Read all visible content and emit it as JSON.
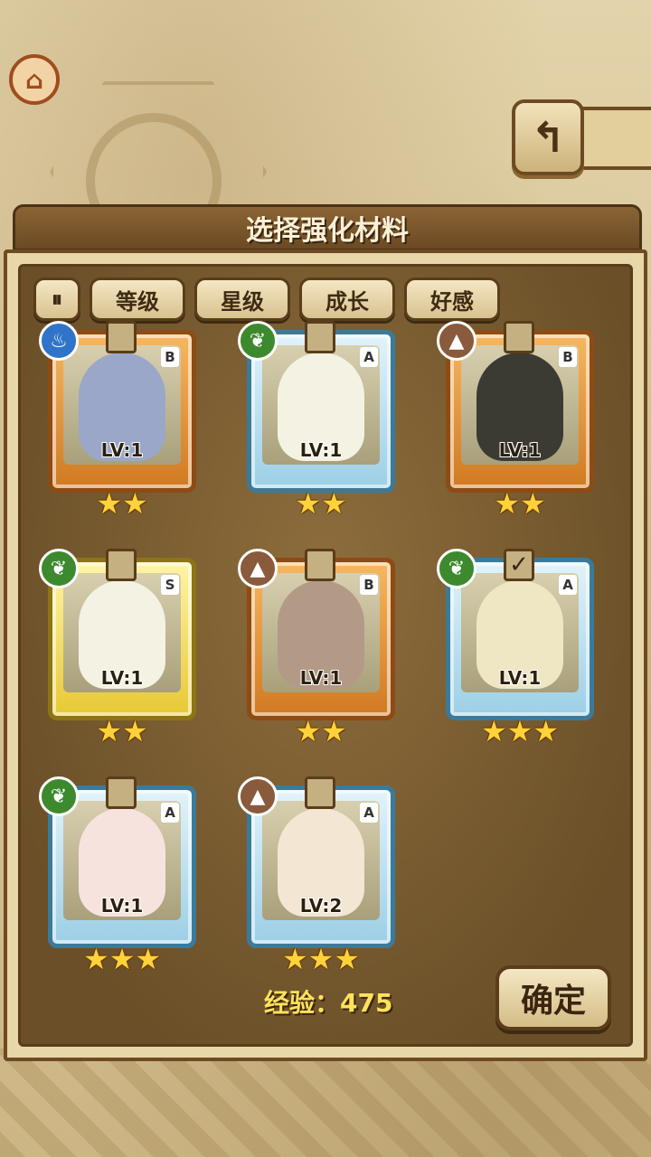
{
  "header": {
    "title": "选择强化材料",
    "back_icon": "return-arrow-icon"
  },
  "filters": {
    "toggle_icon": "sort-toggle-icon",
    "tags": [
      "等级",
      "星级",
      "成长",
      "好感"
    ]
  },
  "cards": [
    {
      "element": "water",
      "rank": "B",
      "level": "LV:1",
      "stars": 2,
      "selected": false
    },
    {
      "element": "grass",
      "rank": "A",
      "level": "LV:1",
      "stars": 2,
      "selected": false
    },
    {
      "element": "earth",
      "rank": "B",
      "level": "LV:1",
      "stars": 2,
      "selected": false
    },
    {
      "element": "grass",
      "rank": "S",
      "level": "LV:1",
      "stars": 2,
      "selected": false
    },
    {
      "element": "earth",
      "rank": "B",
      "level": "LV:1",
      "stars": 2,
      "selected": false
    },
    {
      "element": "grass",
      "rank": "A",
      "level": "LV:1",
      "stars": 3,
      "selected": true
    },
    {
      "element": "grass",
      "rank": "A",
      "level": "LV:1",
      "stars": 3,
      "selected": false
    },
    {
      "element": "earth",
      "rank": "A",
      "level": "LV:2",
      "stars": 3,
      "selected": false
    }
  ],
  "exp_label": "经验：475",
  "confirm_label": "确定",
  "colors": {
    "rank_b": "#d07a22",
    "rank_a": "#9ccfe6",
    "rank_s": "#e7c934",
    "star": "#ffd23a",
    "exp_text": "#ffe25a"
  }
}
